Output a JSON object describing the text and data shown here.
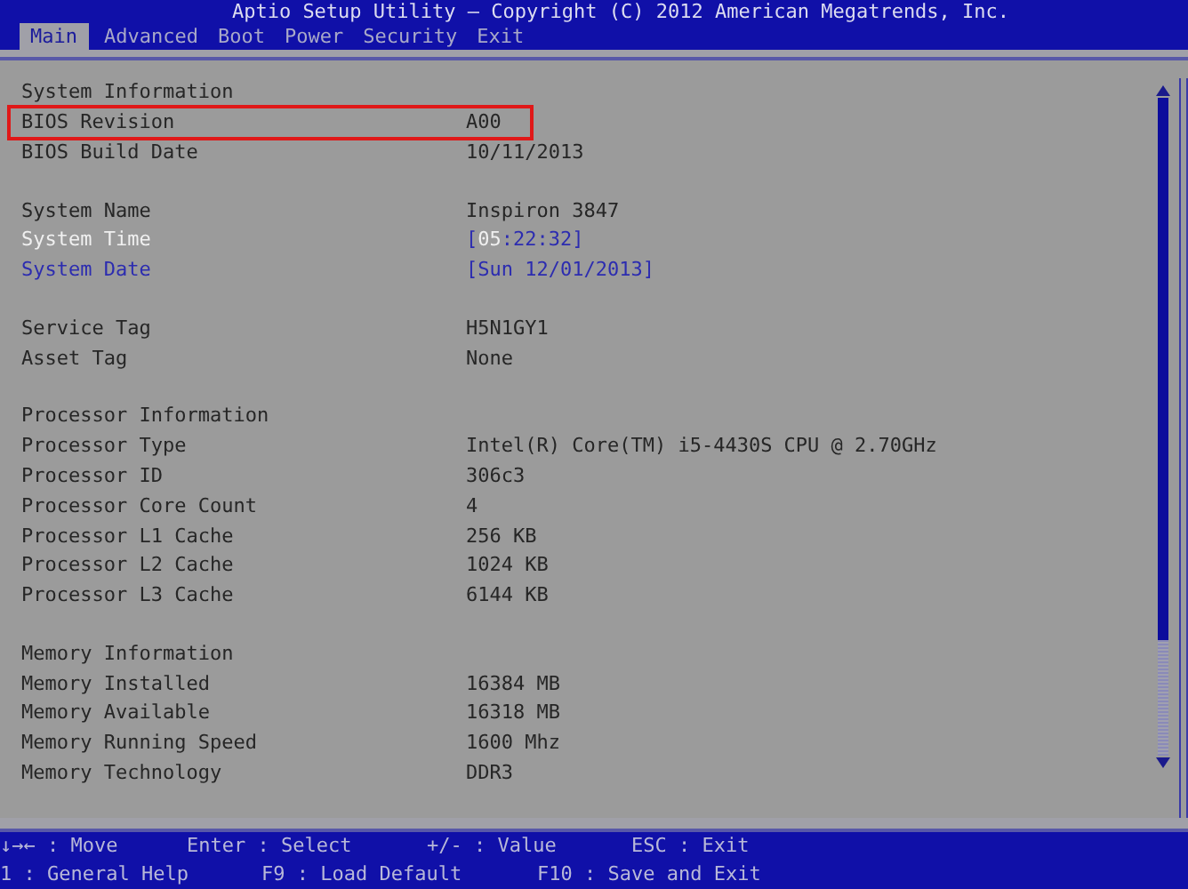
{
  "window": {
    "title": "Aptio Setup Utility – Copyright (C) 2012 American Megatrends, Inc."
  },
  "tabs": [
    {
      "label": "Main",
      "selected": true
    },
    {
      "label": "Advanced",
      "selected": false
    },
    {
      "label": "Boot",
      "selected": false
    },
    {
      "label": "Power",
      "selected": false
    },
    {
      "label": "Security",
      "selected": false
    },
    {
      "label": "Exit",
      "selected": false
    }
  ],
  "sections": [
    [
      {
        "kind": "header",
        "label": "System Information"
      },
      {
        "kind": "info",
        "label": "BIOS Revision",
        "value": "A00",
        "outlined": true
      },
      {
        "kind": "info",
        "label": "BIOS Build Date",
        "value": "10/11/2013",
        "outlined": false
      }
    ],
    [
      {
        "kind": "info",
        "label": "System Name",
        "value": "Inspiron 3847",
        "outlined": false
      },
      {
        "kind": "field",
        "label": "System Time",
        "selected": true,
        "value_parts": [
          {
            "text": "[",
            "focused": false
          },
          {
            "text": "05",
            "focused": true
          },
          {
            "text": ":22:32]",
            "focused": false
          }
        ]
      },
      {
        "kind": "field",
        "label": "System Date",
        "selected": false,
        "value_parts": [
          {
            "text": "[Sun 12/01/2013]",
            "focused": false
          }
        ]
      }
    ],
    [
      {
        "kind": "info",
        "label": "Service Tag",
        "value": "H5N1GY1",
        "outlined": false
      },
      {
        "kind": "info",
        "label": "Asset Tag",
        "value": "None",
        "outlined": false
      }
    ],
    [
      {
        "kind": "header",
        "label": "Processor Information"
      },
      {
        "kind": "info",
        "label": "Processor Type",
        "value": "Intel(R) Core(TM) i5-4430S CPU @ 2.70GHz",
        "outlined": false
      },
      {
        "kind": "info",
        "label": "Processor ID",
        "value": "306c3",
        "outlined": false
      },
      {
        "kind": "info",
        "label": "Processor Core Count",
        "value": "4",
        "outlined": false
      },
      {
        "kind": "info",
        "label": "Processor L1 Cache",
        "value": "256 KB",
        "outlined": false
      },
      {
        "kind": "info",
        "label": "Processor L2 Cache",
        "value": "1024 KB",
        "outlined": false
      },
      {
        "kind": "info",
        "label": "Processor L3 Cache",
        "value": "6144 KB",
        "outlined": false
      }
    ],
    [
      {
        "kind": "header",
        "label": "Memory Information"
      },
      {
        "kind": "info",
        "label": "Memory Installed",
        "value": "16384 MB",
        "outlined": false
      },
      {
        "kind": "info",
        "label": "Memory Available",
        "value": "16318 MB",
        "outlined": false
      },
      {
        "kind": "info",
        "label": "Memory Running Speed",
        "value": "1600 Mhz",
        "outlined": false
      },
      {
        "kind": "info",
        "label": "Memory Technology",
        "value": "DDR3",
        "outlined": false
      }
    ]
  ],
  "help_lines": [
    [
      "↓→← : Move",
      "Enter : Select",
      "+/- : Value",
      "ESC : Exit"
    ],
    [
      "1 : General Help",
      "F9 : Load Default",
      "F10 : Save and Exit"
    ]
  ]
}
